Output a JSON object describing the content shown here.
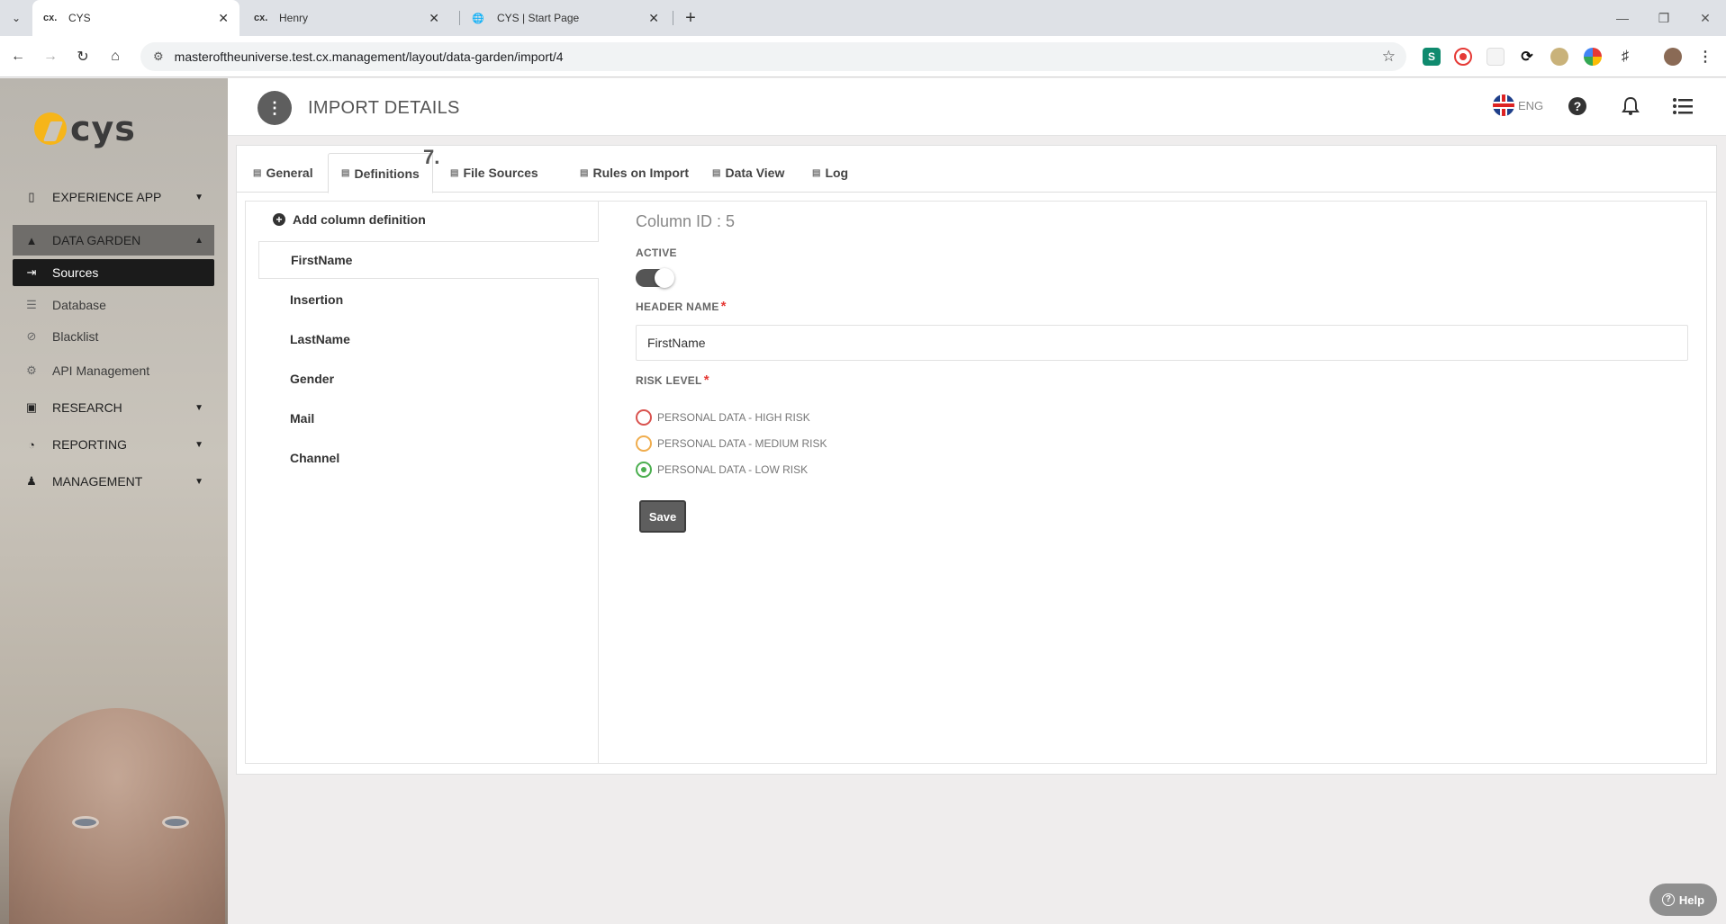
{
  "browser": {
    "tabs": [
      {
        "favicon": "cx.",
        "title": "CYS"
      },
      {
        "favicon": "cx.",
        "title": "Henry"
      },
      {
        "favicon": "globe-icon",
        "title": "CYS | Start Page"
      }
    ],
    "url": "masteroftheuniverse.test.cx.management/layout/data-garden/import/4"
  },
  "sidebar": {
    "logo_text": "cys",
    "items": [
      {
        "label": "EXPERIENCE APP",
        "icon": "phone-icon"
      },
      {
        "label": "DATA GARDEN",
        "icon": "tree-icon"
      },
      {
        "label": "Sources",
        "icon": "import-icon"
      },
      {
        "label": "Database",
        "icon": "database-icon"
      },
      {
        "label": "Blacklist",
        "icon": "ban-icon"
      },
      {
        "label": "API Management",
        "icon": "gear-icon"
      },
      {
        "label": "RESEARCH",
        "icon": "inbox-icon"
      },
      {
        "label": "REPORTING",
        "icon": "pie-chart-icon"
      },
      {
        "label": "MANAGEMENT",
        "icon": "user-icon"
      }
    ]
  },
  "header": {
    "title": "IMPORT DETAILS",
    "language": "ENG"
  },
  "tabs": [
    {
      "label": "General"
    },
    {
      "label": "Definitions"
    },
    {
      "label": "File Sources"
    },
    {
      "label": "Rules on Import"
    },
    {
      "label": "Data View"
    },
    {
      "label": "Log"
    }
  ],
  "step_marker": "7.",
  "columns": {
    "add_label": "Add column definition",
    "items": [
      "FirstName",
      "Insertion",
      "LastName",
      "Gender",
      "Mail",
      "Channel"
    ]
  },
  "form": {
    "column_id": "Column ID : 5",
    "active_label": "ACTIVE",
    "active": true,
    "header_name_label": "HEADER NAME",
    "header_name_value": "FirstName",
    "required_mark": "*",
    "risk_level_label": "RISK LEVEL",
    "risk_options": [
      {
        "label": "PERSONAL DATA - HIGH RISK",
        "color": "#d9534f",
        "selected": false
      },
      {
        "label": "PERSONAL DATA - MEDIUM RISK",
        "color": "#f0ad4e",
        "selected": false
      },
      {
        "label": "PERSONAL DATA - LOW RISK",
        "color": "#4caf50",
        "selected": true
      }
    ],
    "save_label": "Save"
  },
  "help_label": "Help"
}
